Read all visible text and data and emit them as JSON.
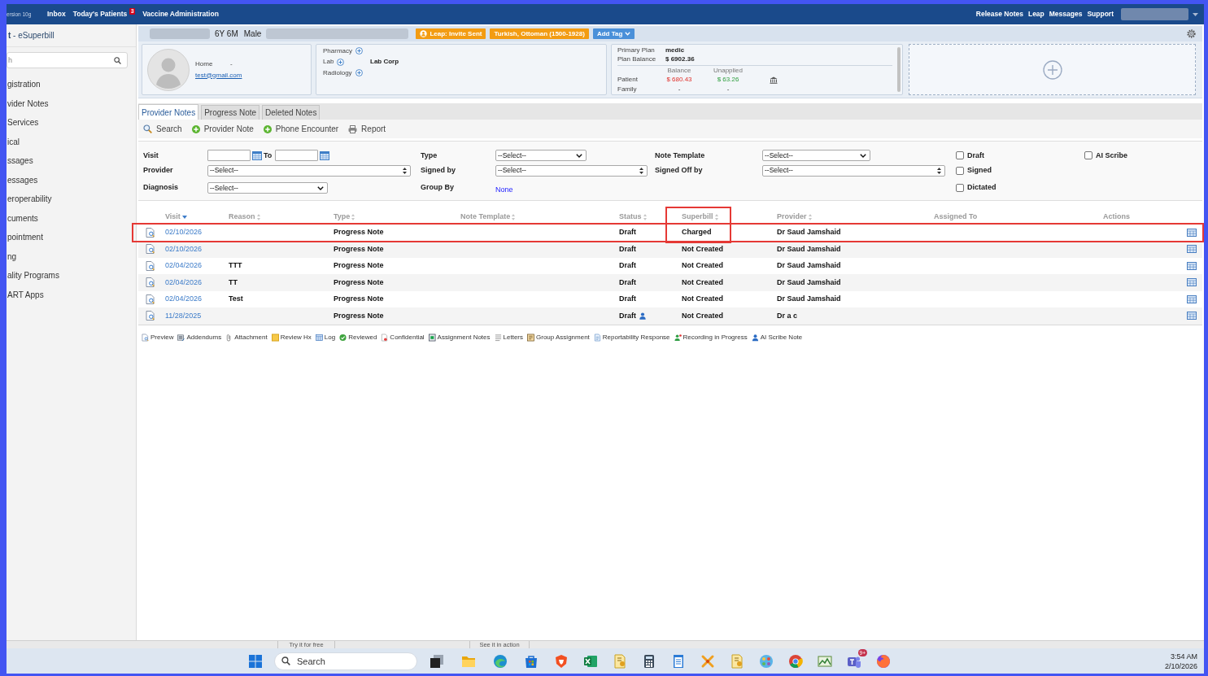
{
  "top_nav": {
    "version": "ersion 10g",
    "links": [
      {
        "label": "Inbox"
      },
      {
        "label": "Today's Patients",
        "badge": "3"
      },
      {
        "label": "Vaccine Administration"
      }
    ],
    "right_links": [
      {
        "label": "Release Notes"
      },
      {
        "label": "Leap"
      },
      {
        "label": "Messages"
      },
      {
        "label": "Support"
      }
    ]
  },
  "sidebar": {
    "title": "**t** - eSuperbill",
    "search": {
      "placeholder": "h"
    },
    "items": [
      {
        "label": "gistration"
      },
      {
        "label": "vider Notes"
      },
      {
        "label": "Services"
      },
      {
        "label": "ical"
      },
      {
        "label": "ssages"
      },
      {
        "label": "essages"
      },
      {
        "label": "eroperability"
      },
      {
        "label": "cuments"
      },
      {
        "label": "pointment"
      },
      {
        "label": "ng"
      },
      {
        "label": "ality Programs"
      },
      {
        "label": "ART Apps"
      }
    ]
  },
  "patient_bar": {
    "age": "6Y 6M",
    "sex": "Male",
    "tags": [
      {
        "label": "Leap: Invite Sent",
        "kind": "leap"
      },
      {
        "label": "Turkish, Ottoman (1500-1928)",
        "kind": "plain"
      }
    ],
    "add_tag": "Add Tag"
  },
  "contact": {
    "phone_label": "Home",
    "phone": "-",
    "email": "test@gmail.com"
  },
  "services": [
    {
      "label": "Pharmacy"
    },
    {
      "label": "Lab",
      "value": "Lab Corp"
    },
    {
      "label": "Radiology"
    }
  ],
  "billing": {
    "plan_rows": [
      {
        "label": "Primary Plan",
        "value": "medic"
      },
      {
        "label": "Plan Balance",
        "value": "$ 6902.36"
      }
    ],
    "columns": [
      "Balance",
      "Unapplied"
    ],
    "rows": [
      {
        "kind": "patient",
        "label": "Patient",
        "balance": "$ 680.43",
        "unapplied": "$ 63.26"
      },
      {
        "kind": "family",
        "label": "Family",
        "balance": "-",
        "unapplied": "-"
      }
    ]
  },
  "tabs": [
    {
      "label": "Provider Notes",
      "selected": true
    },
    {
      "label": "Progress Note",
      "selected": false
    },
    {
      "label": "Deleted Notes",
      "selected": false
    }
  ],
  "toolbar": [
    {
      "kind": "search",
      "label": "Search"
    },
    {
      "kind": "add",
      "label": "Provider Note"
    },
    {
      "kind": "add",
      "label": "Phone Encounter"
    },
    {
      "kind": "print",
      "label": "Report"
    }
  ],
  "filters": {
    "rows": [
      [
        {
          "kind": "date_range",
          "label": "Visit",
          "to_label": "To"
        },
        {
          "kind": "select",
          "label": "Type",
          "value": "--Select--"
        },
        {
          "kind": "select",
          "label": "Note Template",
          "value": "--Select--"
        },
        {
          "kind": "checkbox",
          "label": "Draft",
          "checked": false
        },
        {
          "kind": "checkbox",
          "label": "AI Scribe",
          "checked": false
        }
      ],
      [
        {
          "kind": "combo",
          "label": "Provider",
          "value": "--Select--"
        },
        {
          "kind": "combo",
          "label": "Signed by",
          "value": "--Select--"
        },
        {
          "kind": "combo",
          "label": "Signed Off by",
          "value": "--Select--"
        },
        {
          "kind": "checkbox",
          "label": "Signed",
          "checked": false
        }
      ],
      [
        {
          "kind": "select",
          "label": "Diagnosis",
          "value": "--Select--"
        },
        {
          "kind": "link",
          "label": "Group By",
          "value": "None"
        },
        "",
        {
          "kind": "checkbox",
          "label": "Dictated",
          "checked": false
        }
      ]
    ]
  },
  "table": {
    "columns": [
      {
        "label": "Visit",
        "sortable": true,
        "sorted": true,
        "highlighted": false
      },
      {
        "label": "Reason",
        "sortable": true,
        "sorted": false,
        "highlighted": false
      },
      {
        "label": "Type",
        "sortable": true,
        "sorted": false,
        "highlighted": false
      },
      {
        "label": "Note Template",
        "sortable": true,
        "sorted": false,
        "highlighted": false
      },
      {
        "label": "Status",
        "sortable": true,
        "sorted": false,
        "highlighted": false
      },
      {
        "label": "Superbill",
        "sortable": true,
        "sorted": false,
        "highlighted": true
      },
      {
        "label": "Provider",
        "sortable": true,
        "sorted": false,
        "highlighted": false
      },
      {
        "label": "Assigned To",
        "sortable": false,
        "highlighted": false
      },
      {
        "label": "Actions",
        "sortable": false,
        "highlighted": false
      }
    ],
    "rows": [
      {
        "visit": "02/10/2026",
        "type": "Progress Note",
        "status": "Draft",
        "superbill": "Charged",
        "provider": "Dr Saud Jamshaid",
        "ai_scribe": false,
        "highlighted": true
      },
      {
        "visit": "02/10/2026",
        "type": "Progress Note",
        "status": "Draft",
        "superbill": "Not Created",
        "provider": "Dr Saud Jamshaid",
        "ai_scribe": false,
        "highlighted": false
      },
      {
        "visit": "02/04/2026",
        "reason": "TTT",
        "type": "Progress Note",
        "status": "Draft",
        "superbill": "Not Created",
        "provider": "Dr Saud Jamshaid",
        "ai_scribe": false,
        "highlighted": false
      },
      {
        "visit": "02/04/2026",
        "reason": "TT",
        "type": "Progress Note",
        "status": "Draft",
        "superbill": "Not Created",
        "provider": "Dr Saud Jamshaid",
        "ai_scribe": false,
        "highlighted": false
      },
      {
        "visit": "02/04/2026",
        "reason": "Test",
        "type": "Progress Note",
        "status": "Draft",
        "superbill": "Not Created",
        "provider": "Dr Saud Jamshaid",
        "ai_scribe": false,
        "highlighted": false
      },
      {
        "visit": "11/28/2025",
        "type": "Progress Note",
        "status": "Draft",
        "superbill": "Not Created",
        "provider": "Dr a c",
        "ai_scribe": true,
        "highlighted": false
      }
    ]
  },
  "legend": [
    {
      "kind": "preview",
      "label": "Preview"
    },
    {
      "kind": "addendums",
      "label": "Addendums"
    },
    {
      "kind": "attachment",
      "label": "Attachment"
    },
    {
      "kind": "review_hx",
      "label": "Review Hx"
    },
    {
      "kind": "log",
      "label": "Log"
    },
    {
      "kind": "reviewed",
      "label": "Reviewed"
    },
    {
      "kind": "confidential",
      "label": "Confidential"
    },
    {
      "kind": "assignment_notes",
      "label": "Assignment Notes"
    },
    {
      "kind": "letters",
      "label": "Letters"
    },
    {
      "kind": "group_assignment",
      "label": "Group Assignment"
    },
    {
      "kind": "reportability_response",
      "label": "Reportability Response"
    },
    {
      "kind": "recording",
      "label": "Recording in Progress"
    },
    {
      "kind": "ai_scribe",
      "label": "AI Scribe Note"
    }
  ],
  "bottom_strip": [
    {
      "label": "Try it for free"
    },
    {
      "label": "See it in action"
    }
  ],
  "taskbar": {
    "search_placeholder": "Search",
    "chat_badge": "9+",
    "time": "3:54 AM",
    "date": "2/10/2026"
  }
}
